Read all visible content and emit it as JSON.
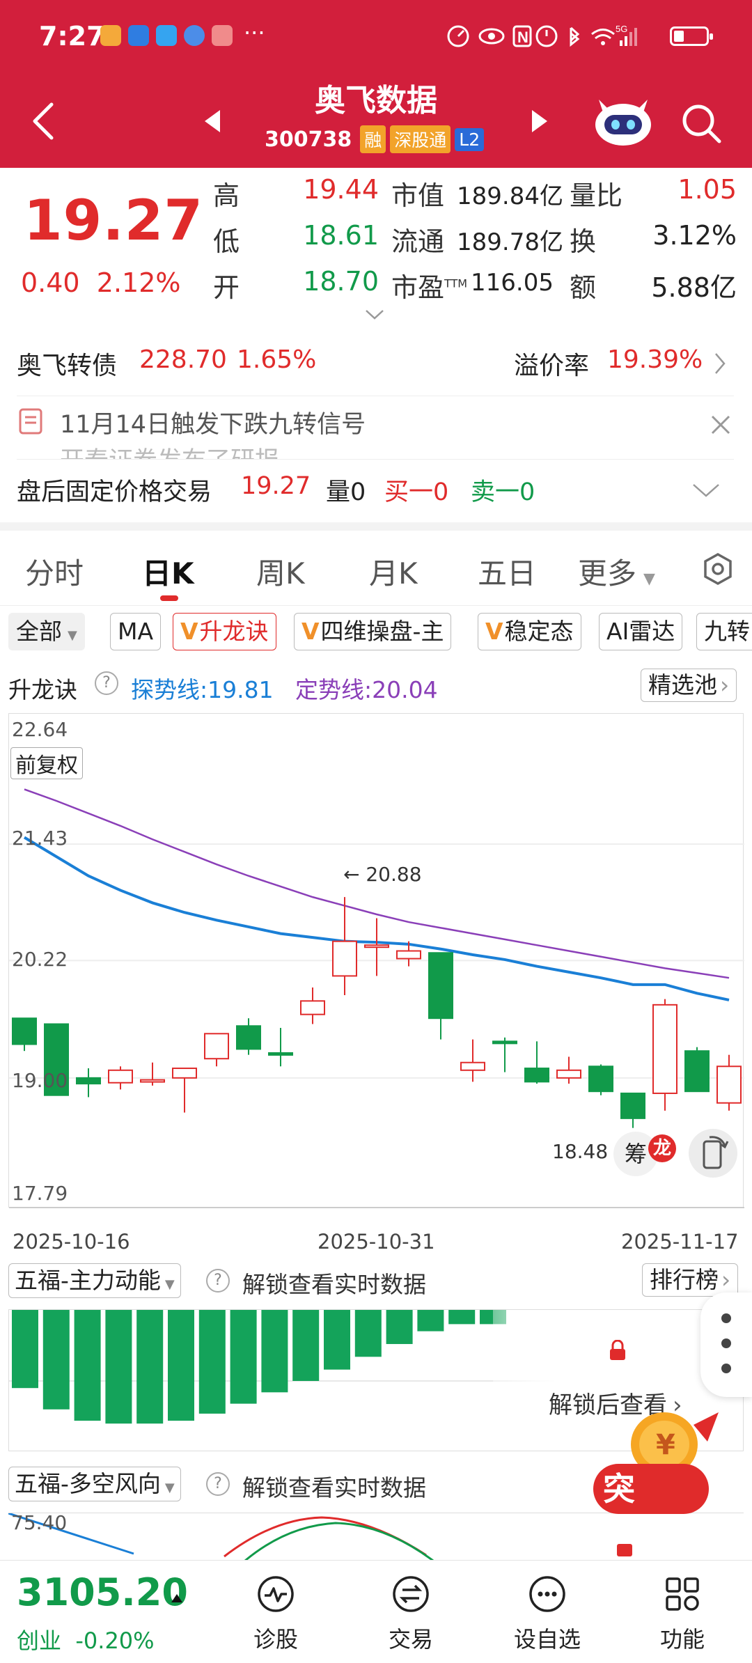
{
  "status_bar": {
    "time": "7:27",
    "dots": "···",
    "network": "5G"
  },
  "header": {
    "stock_name": "奥飞数据",
    "stock_code": "300738",
    "tags": [
      "融",
      "深股通",
      "L2"
    ]
  },
  "quote": {
    "price": "19.27",
    "change": "0.40",
    "change_pct": "2.12%",
    "rows": [
      {
        "label": "高",
        "value": "19.44",
        "label2": "市值",
        "value2": "189.84亿",
        "label3": "量比",
        "value3": "1.05"
      },
      {
        "label": "低",
        "value": "18.61",
        "label2": "流通",
        "value2": "189.78亿",
        "label3": "换",
        "value3": "3.12%"
      },
      {
        "label": "开",
        "value": "18.70",
        "label2": "市盈",
        "sup2": "TTM",
        "value2": "116.05",
        "label3": "额",
        "value3": "5.88亿"
      }
    ]
  },
  "bond": {
    "name": "奥飞转债",
    "price": "228.70",
    "pct": "1.65%",
    "premium_label": "溢价率",
    "premium": "19.39%"
  },
  "notice": {
    "text": "11月14日触发下跌九转信号",
    "text2": "开泰证券发布了研报"
  },
  "after_hours": {
    "label": "盘后固定价格交易",
    "price": "19.27",
    "vol_label": "量",
    "vol": "0",
    "buy_label": "买一",
    "buy": "0",
    "sell_label": "卖一",
    "sell": "0"
  },
  "tabs": [
    "分时",
    "日K",
    "周K",
    "月K",
    "五日",
    "更多"
  ],
  "chips": [
    "全部",
    "MA",
    "升龙诀",
    "四维操盘-主",
    "稳定态",
    "AI雷达",
    "九转"
  ],
  "indicator": {
    "name": "升龙诀",
    "explore_label": "探势线:",
    "explore_value": "19.81",
    "fixed_label": "定势线:",
    "fixed_value": "20.04",
    "pool_btn": "精选池"
  },
  "chart": {
    "fuquan": "前复权",
    "high_annotation": "← 20.88",
    "low_annotation": "18.48",
    "chou_btn": "筹",
    "long_badge": "龙",
    "price_ticks": [
      "22.64",
      "21.43",
      "20.22",
      "19.00",
      "17.79"
    ],
    "dates": [
      "2025-10-16",
      "2025-10-31",
      "2025-11-17"
    ]
  },
  "chart_data": {
    "type": "candlestick",
    "ylim": [
      17.79,
      22.64
    ],
    "candles": [
      {
        "o": 19.62,
        "c": 19.35,
        "h": 19.62,
        "l": 19.28
      },
      {
        "o": 19.56,
        "c": 18.82,
        "h": 19.56,
        "l": 18.82
      },
      {
        "o": 19.0,
        "c": 18.94,
        "h": 19.1,
        "l": 18.8
      },
      {
        "o": 18.95,
        "c": 19.08,
        "h": 19.12,
        "l": 18.88
      },
      {
        "o": 18.98,
        "c": 18.98,
        "h": 19.16,
        "l": 18.92
      },
      {
        "o": 19.0,
        "c": 19.1,
        "h": 19.1,
        "l": 18.64
      },
      {
        "o": 19.2,
        "c": 19.46,
        "h": 19.46,
        "l": 19.12
      },
      {
        "o": 19.54,
        "c": 19.3,
        "h": 19.62,
        "l": 19.24
      },
      {
        "o": 19.26,
        "c": 19.24,
        "h": 19.52,
        "l": 19.12
      },
      {
        "o": 19.66,
        "c": 19.8,
        "h": 19.94,
        "l": 19.56
      },
      {
        "o": 20.06,
        "c": 20.42,
        "h": 20.88,
        "l": 19.86
      },
      {
        "o": 20.36,
        "c": 20.38,
        "h": 20.66,
        "l": 20.06
      },
      {
        "o": 20.24,
        "c": 20.32,
        "h": 20.42,
        "l": 20.16
      },
      {
        "o": 20.3,
        "c": 19.62,
        "h": 20.3,
        "l": 19.4
      },
      {
        "o": 19.08,
        "c": 19.16,
        "h": 19.4,
        "l": 18.96
      },
      {
        "o": 19.38,
        "c": 19.36,
        "h": 19.42,
        "l": 19.06
      },
      {
        "o": 19.1,
        "c": 18.96,
        "h": 19.38,
        "l": 18.94
      },
      {
        "o": 19.0,
        "c": 19.08,
        "h": 19.22,
        "l": 18.94
      },
      {
        "o": 19.12,
        "c": 18.86,
        "h": 19.14,
        "l": 18.82
      },
      {
        "o": 18.84,
        "c": 18.58,
        "h": 18.84,
        "l": 18.48
      },
      {
        "o": 18.84,
        "c": 19.76,
        "h": 19.82,
        "l": 18.66
      },
      {
        "o": 19.28,
        "c": 18.86,
        "h": 19.32,
        "l": 18.86
      },
      {
        "o": 18.74,
        "c": 19.12,
        "h": 19.24,
        "l": 18.66
      }
    ],
    "lines": [
      {
        "name": "探势线",
        "color": "#1a7fd6",
        "values": [
          21.5,
          21.3,
          21.1,
          20.95,
          20.82,
          20.72,
          20.64,
          20.57,
          20.5,
          20.46,
          20.42,
          20.41,
          20.39,
          20.34,
          20.28,
          20.23,
          20.16,
          20.1,
          20.04,
          19.97,
          19.97,
          19.88,
          19.81
        ]
      },
      {
        "name": "定势线",
        "color": "#8a3fb8",
        "values": [
          22.0,
          21.88,
          21.75,
          21.62,
          21.48,
          21.35,
          21.22,
          21.1,
          20.99,
          20.88,
          20.79,
          20.7,
          20.62,
          20.56,
          20.5,
          20.44,
          20.38,
          20.32,
          20.26,
          20.2,
          20.14,
          20.09,
          20.04
        ]
      }
    ]
  },
  "sub_panel_1": {
    "name": "五福-主力动能",
    "unlock": "解锁查看实时数据",
    "rank_btn": "排行榜",
    "locked_text": "解锁后查看"
  },
  "sub_panel_2": {
    "name": "五福-多空风向",
    "unlock": "解锁查看实时数据",
    "tick": "75.40"
  },
  "vol_bars": [
    0.55,
    0.7,
    0.78,
    0.8,
    0.8,
    0.78,
    0.73,
    0.66,
    0.58,
    0.5,
    0.42,
    0.33,
    0.24,
    0.15,
    0.1,
    0.1
  ],
  "promo": {
    "text": "突"
  },
  "bottom_bar": {
    "index_value": "3105.20",
    "index_name": "创业",
    "index_pct": "-0.20%",
    "items": [
      "诊股",
      "交易",
      "设自选",
      "功能"
    ]
  },
  "colors": {
    "brand": "#d21f3c",
    "up": "#e02b2b",
    "down": "#119a4a",
    "explore_line": "#1a7fd6",
    "fixed_line": "#8a3fb8"
  }
}
